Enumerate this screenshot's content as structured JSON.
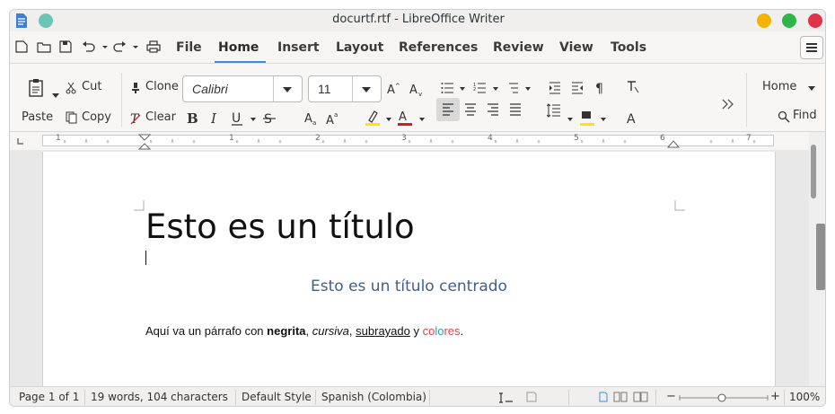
{
  "window": {
    "title": "docurtf.rtf - LibreOffice Writer"
  },
  "menu": {
    "items": [
      "File",
      "Home",
      "Insert",
      "Layout",
      "References",
      "Review",
      "View",
      "Tools"
    ],
    "active": "Home"
  },
  "ribbon": {
    "paste_label": "Paste",
    "cut_label": "Cut",
    "copy_label": "Copy",
    "clone_label": "Clone",
    "clear_label": "Clear",
    "font_name": "Calibri",
    "font_size": "11",
    "tab_dropdown": "Home",
    "find_label": "Find"
  },
  "ruler": {
    "numbers": [
      "1",
      "1",
      "2",
      "3",
      "4",
      "5",
      "6",
      "7"
    ]
  },
  "document": {
    "title": "Esto es un título",
    "subtitle": "Esto es un título centrado",
    "para_start": "Aquí va un párrafo con ",
    "bold": "negrita",
    "comma1": ", ",
    "italic": "cursiva",
    "comma2": ", ",
    "underline": "subrayado",
    "and": " y ",
    "color_1": "co",
    "color_2": "lo",
    "color_3": "res",
    "period": "."
  },
  "status": {
    "page": "Page 1 of 1",
    "words": "19 words, 104 characters",
    "style": "Default Style",
    "language": "Spanish (Colombia)",
    "zoom": "100%"
  },
  "colors": {
    "accent": "#3d8de0",
    "subtitle": "#3e5f8d",
    "close": "#e0334a",
    "maximize": "#2db54a",
    "minimize": "#f3b400",
    "pin": "#6cc5b5"
  }
}
